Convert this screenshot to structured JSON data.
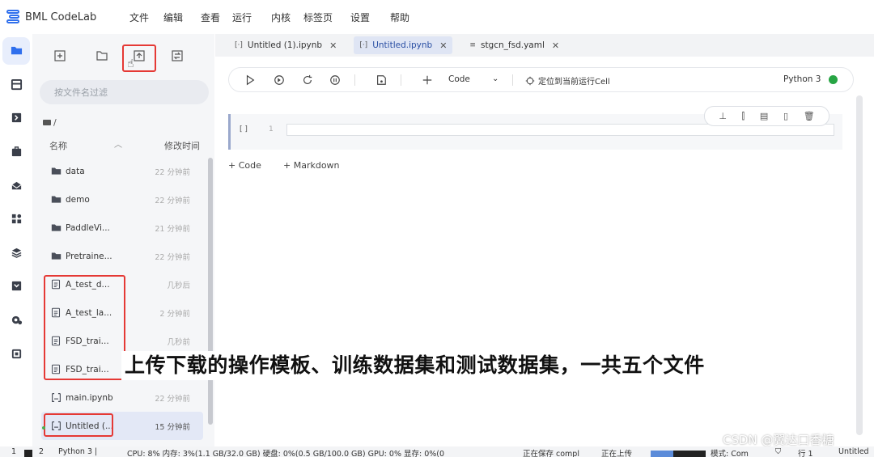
{
  "app": {
    "title": "BML CodeLab"
  },
  "menu": [
    "文件",
    "编辑",
    "查看",
    "运行",
    "内核",
    "标签页",
    "设置",
    "帮助"
  ],
  "activity_bar": {
    "items": [
      "folder-icon",
      "database-icon",
      "dataset-icon",
      "toolbox-icon",
      "inbox-icon",
      "apps-icon",
      "layers-icon",
      "download-box-icon",
      "gear-cloud-icon",
      "chip-icon"
    ],
    "active_index": 0
  },
  "file_panel": {
    "search_placeholder": "按文件名过滤",
    "breadcrumb": "/",
    "headers": {
      "name": "名称",
      "modified": "修改时间"
    },
    "files": [
      {
        "name": "data",
        "time": "22 分钟前",
        "type": "folder"
      },
      {
        "name": "demo",
        "time": "22 分钟前",
        "type": "folder"
      },
      {
        "name": "PaddleVi...",
        "time": "21 分钟前",
        "type": "folder"
      },
      {
        "name": "Pretraine...",
        "time": "22 分钟前",
        "type": "folder"
      },
      {
        "name": "A_test_d...",
        "time": "几秒后",
        "type": "file"
      },
      {
        "name": "A_test_la...",
        "time": "2 分钟前",
        "type": "file"
      },
      {
        "name": "FSD_trai...",
        "time": "几秒前",
        "type": "file"
      },
      {
        "name": "FSD_trai...",
        "time": "几秒前",
        "type": "file"
      },
      {
        "name": "main.ipynb",
        "time": "22 分钟前",
        "type": "notebook"
      },
      {
        "name": "Untitled (...",
        "time": "15 分钟前",
        "type": "notebook",
        "selected": true
      }
    ]
  },
  "tabs": [
    {
      "label": "Untitled (1).ipynb",
      "active": false,
      "icon": "notebook-icon"
    },
    {
      "label": "Untitled.ipynb",
      "active": true,
      "icon": "notebook-icon"
    },
    {
      "label": "stgcn_fsd.yaml",
      "active": false,
      "icon": "text-file-icon"
    }
  ],
  "notebook_toolbar": {
    "cell_type": "Code",
    "locate_label": "定位到当前运行Cell",
    "kernel": "Python 3",
    "kernel_status_color": "#27a544"
  },
  "cell": {
    "prompt": "[ ]",
    "line_number": "1"
  },
  "add_buttons": {
    "code": "+ Code",
    "markdown": "+ Markdown"
  },
  "subtitle": "上传下载的操作模板、训练数据集和测试数据集，一共五个文件",
  "watermark": "CSDN @翼达口香糖",
  "status_bar": {
    "items": [
      "1",
      "2",
      "Python 3 |",
      "CPU: 8% 内存: 3%(1.1 GB/32.0 GB) 硬盘: 0%(0.5 GB/100.0 GB) GPU: 0% 显存: 0%(0",
      "正在保存 compl",
      "正在上传",
      "模式: Com",
      "行 1",
      "Untitled"
    ]
  },
  "colors": {
    "accent": "#2f6fed",
    "highlight_red": "#e53935"
  }
}
